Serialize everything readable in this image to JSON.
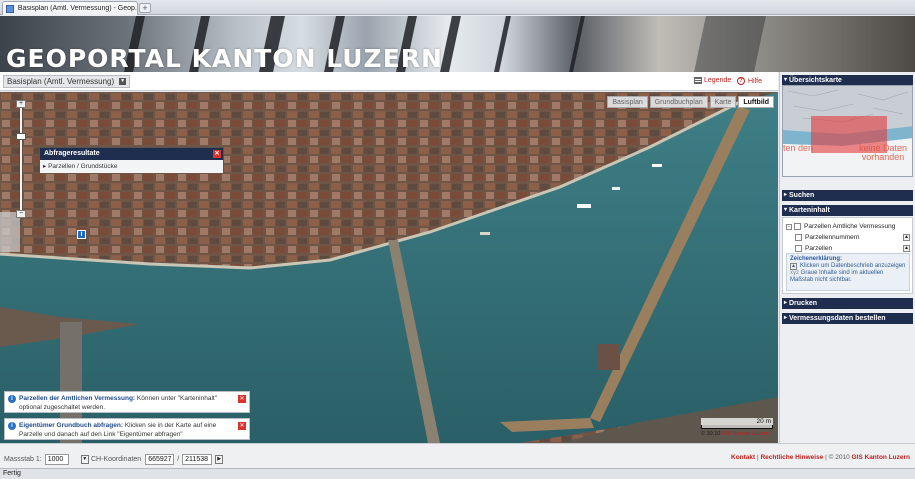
{
  "browser": {
    "tab_title": "Basisplan (Amtl. Vermessung) - Geop...",
    "new_tab": "+",
    "status": "Fertig"
  },
  "banner": {
    "title": "GEOPORTAL KANTON LUZERN"
  },
  "header": {
    "layer_select": "Basisplan (Amtl. Vermessung)",
    "legend_link": "Legende",
    "help_link": "Hilfe",
    "help_icon": "?"
  },
  "map": {
    "tabs": [
      "Basisplan",
      "Grundbuchplan",
      "Karte",
      "Luftbild"
    ],
    "active_tab": "Luftbild",
    "zoom_in": "+",
    "zoom_out": "−",
    "popup": {
      "title": "Abfrageresultate",
      "row": "Parzellen / Grundstücke"
    },
    "pin_label": "i",
    "scale_label": "20 m",
    "copyright_prefix": "© 30.10 ",
    "copyright_brand": "GIS Kanton Luzern",
    "messages": [
      {
        "title": "Parzellen der Amtlichen Vermessung:",
        "text": " Können unter \"Karteninhalt\" optional zugeschaltet werden."
      },
      {
        "title": "Eigentümer Grundbuch abfragen:",
        "text": " Klicken sie in der Karte auf eine Parzelle und danach auf den Link \"Eigentümer abfragen\""
      }
    ]
  },
  "sidebar": {
    "overview_title": "Übersichtskarte",
    "overview_nodata_1": "keine Daten vorhanden",
    "overview_nodata_2": "ten den",
    "search_title": "Suchen",
    "content_title": "Karteninhalt",
    "tree": {
      "group": "Parzellen Amtliche Vermessung",
      "items": [
        "Parzellennummern",
        "Parzellen"
      ]
    },
    "legend_title": "Zeichenerklärung:",
    "legend_line_1": "Klicken um Datenbeschrieb anzuzeigen",
    "legend_line_2": "Graue Inhalte sind im aktuellen Maßstab nicht sichtbar.",
    "legend_prefix": "xyz",
    "print_title": "Drucken",
    "order_title": "Vermessungsdaten bestellen"
  },
  "footer": {
    "scale_label": "Massstab 1:",
    "scale_value": "1000",
    "coord_label": "CH-Koordinaten",
    "coord_x": "665927",
    "coord_sep": "/",
    "coord_y": "211538",
    "link_contact": "Kontakt",
    "sep1": " | ",
    "link_legal": "Rechtliche Hinweise",
    "copyright_text": " | © 2010 ",
    "copyright_brand": "GIS Kanton Luzern"
  },
  "colors": {
    "navy": "#1f2d4f",
    "accent_red": "#c0201e",
    "water": "#2f6b73"
  }
}
